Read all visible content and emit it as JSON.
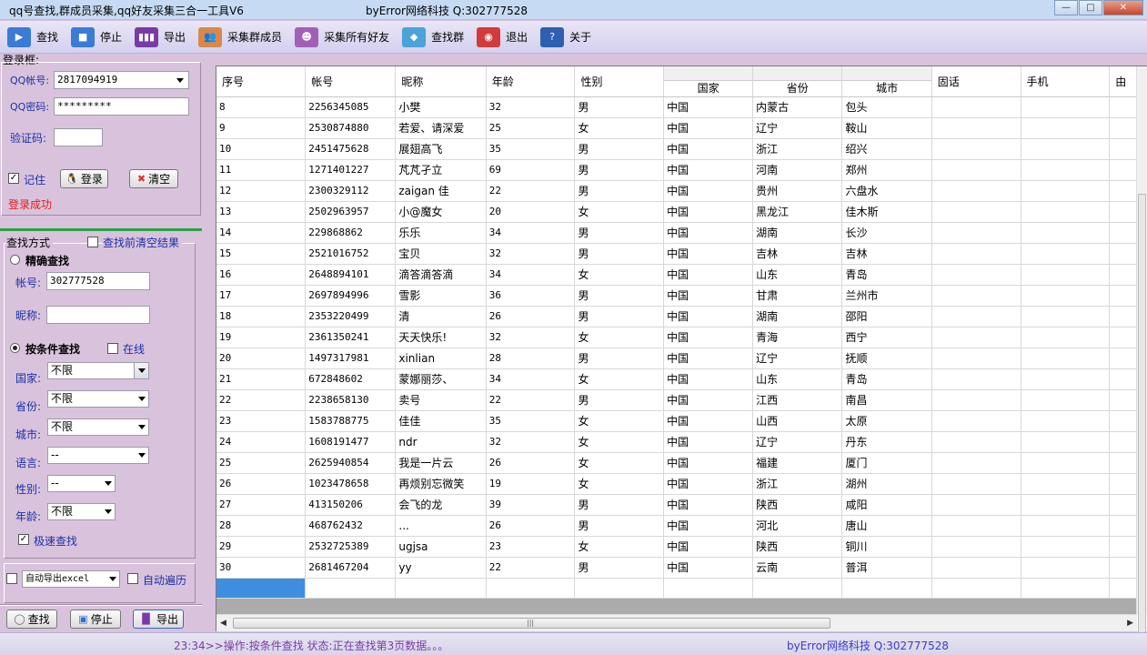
{
  "window": {
    "title": "qq号查找,群成员采集,qq好友采集三合一工具V6",
    "subtitle": "byError网络科技 Q:302777528"
  },
  "toolbar": [
    {
      "label": "查找",
      "icon": "play-icon",
      "color": "#3a7bd5"
    },
    {
      "label": "停止",
      "icon": "stop-icon",
      "color": "#3a7bd5"
    },
    {
      "label": "导出",
      "icon": "bar-chart-icon",
      "color": "#7a3aa6"
    },
    {
      "label": "采集群成员",
      "icon": "users-icon",
      "color": "#d9884a"
    },
    {
      "label": "采集所有好友",
      "icon": "friend-avatar-icon",
      "color": "#a35fb8"
    },
    {
      "label": "查找群",
      "icon": "cubes-icon",
      "color": "#4aa3d9"
    },
    {
      "label": "退出",
      "icon": "exit-icon",
      "color": "#d13b3b"
    },
    {
      "label": "关于",
      "icon": "help-icon",
      "color": "#2f5fb0"
    }
  ],
  "login": {
    "group_label": "登录框:",
    "qq_label": "QQ帐号:",
    "qq_value": "2817094919",
    "pwd_label": "QQ密码:",
    "pwd_value": "*********",
    "captcha_label": "验证码:",
    "captcha_value": "",
    "remember_label": "记住",
    "remember_checked": true,
    "login_button": "登录",
    "clear_button": "清空",
    "status": "登录成功",
    "status_color": "#e21c1c"
  },
  "search": {
    "group_label": "查找方式",
    "clear_before_label": "查找前清空结果",
    "exact_label": "精确查找",
    "account_label": "帐号:",
    "account_value": "302777528",
    "nickname_label": "昵称:",
    "nickname_value": "",
    "condition_label": "按条件查找",
    "online_label": "在线",
    "country_label": "国家:",
    "country_value": "不限",
    "province_label": "省份:",
    "province_value": "不限",
    "city_label": "城市:",
    "city_value": "不限",
    "language_label": "语言:",
    "language_value": "--",
    "gender_label": "性别:",
    "gender_value": "--",
    "age_label": "年龄:",
    "age_value": "不限",
    "fast_label": "极速查找",
    "fast_checked": true,
    "auto_export_value": "自动导出excel",
    "auto_traverse_label": "自动遍历"
  },
  "bottom_buttons": {
    "search": "查找",
    "stop": "停止",
    "export": "导出"
  },
  "grid": {
    "columns": [
      "序号",
      "帐号",
      "昵称",
      "年龄",
      "性别",
      "国家",
      "省份",
      "城市",
      "固话",
      "手机",
      "由"
    ],
    "rows": [
      [
        "8",
        "2256345085",
        "小樊",
        "32",
        "男",
        "中国",
        "内蒙古",
        "包头",
        "",
        ""
      ],
      [
        "9",
        "2530874880",
        "若爱、请深爱",
        "25",
        "女",
        "中国",
        "辽宁",
        "鞍山",
        "",
        ""
      ],
      [
        "10",
        "2451475628",
        "展翅高飞",
        "35",
        "男",
        "中国",
        "浙江",
        "绍兴",
        "",
        ""
      ],
      [
        "11",
        "1271401227",
        "芃芃孑立",
        "69",
        "男",
        "中国",
        "河南",
        "郑州",
        "",
        ""
      ],
      [
        "12",
        "2300329112",
        "zaigan 佳",
        "22",
        "男",
        "中国",
        "贵州",
        "六盘水",
        "",
        ""
      ],
      [
        "13",
        "2502963957",
        "小@魔女",
        "20",
        "女",
        "中国",
        "黑龙江",
        "佳木斯",
        "",
        ""
      ],
      [
        "14",
        "229868862",
        "乐乐",
        "34",
        "男",
        "中国",
        "湖南",
        "长沙",
        "",
        ""
      ],
      [
        "15",
        "2521016752",
        "宝贝",
        "32",
        "男",
        "中国",
        "吉林",
        "吉林",
        "",
        ""
      ],
      [
        "16",
        "2648894101",
        "滴答滴答滴",
        "34",
        "女",
        "中国",
        "山东",
        "青岛",
        "",
        ""
      ],
      [
        "17",
        "2697894996",
        "雪影",
        "36",
        "男",
        "中国",
        "甘肃",
        "兰州市",
        "",
        ""
      ],
      [
        "18",
        "2353220499",
        "清",
        "26",
        "男",
        "中国",
        "湖南",
        "邵阳",
        "",
        ""
      ],
      [
        "19",
        "2361350241",
        "天天快乐!",
        "32",
        "女",
        "中国",
        "青海",
        "西宁",
        "",
        ""
      ],
      [
        "20",
        "1497317981",
        "xinlian",
        "28",
        "男",
        "中国",
        "辽宁",
        "抚顺",
        "",
        ""
      ],
      [
        "21",
        "672848602",
        "蒙娜丽莎、",
        "34",
        "女",
        "中国",
        "山东",
        "青岛",
        "",
        ""
      ],
      [
        "22",
        "2238658130",
        "卖号",
        "22",
        "男",
        "中国",
        "江西",
        "南昌",
        "",
        ""
      ],
      [
        "23",
        "1583788775",
        "佳佳",
        "35",
        "女",
        "中国",
        "山西",
        "太原",
        "",
        ""
      ],
      [
        "24",
        "1608191477",
        "ndr",
        "32",
        "女",
        "中国",
        "辽宁",
        "丹东",
        "",
        ""
      ],
      [
        "25",
        "2625940854",
        "我是一片云",
        "26",
        "女",
        "中国",
        "福建",
        "厦门",
        "",
        ""
      ],
      [
        "26",
        "1023478658",
        "再烦别忘微笑",
        "19",
        "女",
        "中国",
        "浙江",
        "湖州",
        "",
        ""
      ],
      [
        "27",
        "413150206",
        "会飞的龙",
        "39",
        "男",
        "中国",
        "陕西",
        "咸阳",
        "",
        ""
      ],
      [
        "28",
        "468762432",
        "...",
        "26",
        "男",
        "中国",
        "河北",
        "唐山",
        "",
        ""
      ],
      [
        "29",
        "2532725389",
        "ugjsa",
        "23",
        "女",
        "中国",
        "陕西",
        "铜川",
        "",
        ""
      ],
      [
        "30",
        "2681467204",
        "yy",
        "22",
        "男",
        "中国",
        "云南",
        "普洱",
        "",
        ""
      ]
    ]
  },
  "status": {
    "left": "23:34>>操作:按条件查找 状态:正在查找第3页数据。。。",
    "right": "byError网络科技 Q:302777528"
  }
}
